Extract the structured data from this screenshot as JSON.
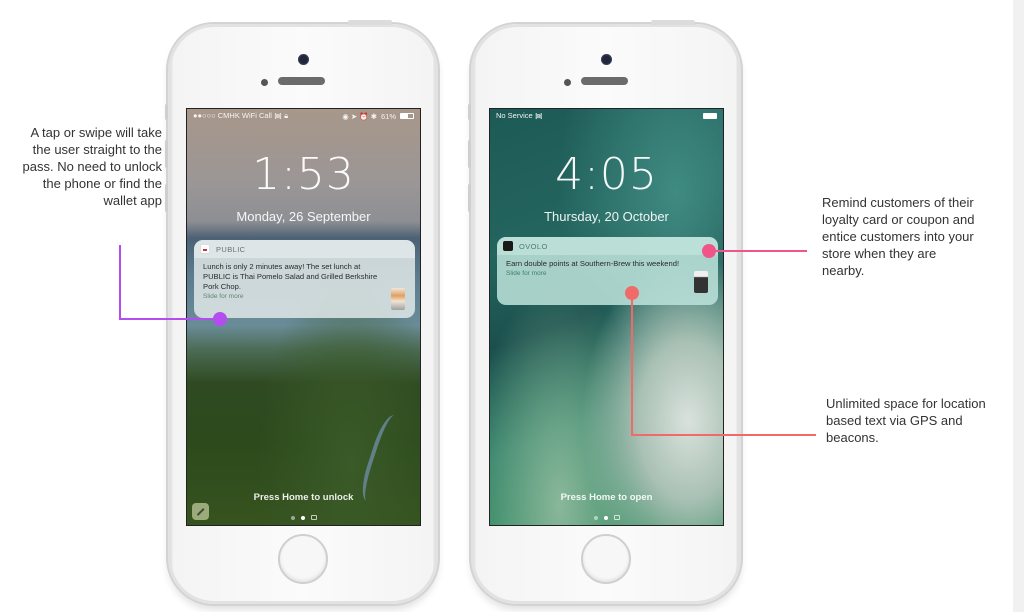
{
  "callouts": {
    "left": "A tap or swipe will take the user straight to the pass. No need to unlock the phone or find the wallet app",
    "right_top": "Remind customers of their loyalty card or coupon and entice customers into your store when they are nearby.",
    "right_bottom": "Unlimited space for location based text via GPS and beacons."
  },
  "colors": {
    "purple_marker": "#b44df0",
    "pink_marker": "#f0558a",
    "coral_marker": "#f06a6a"
  },
  "phones": [
    {
      "status": {
        "carrier": "●●○○○ CMHK WiFi Call",
        "wifi_icon": "wifi-icon",
        "lock_icon": "lock-icon",
        "right_icons": "◉ ➤ ⏰ ✱",
        "battery_text": "61%",
        "battery_level": 0.61
      },
      "time": "1:53",
      "date": "Monday, 26 September",
      "notification": {
        "app": "PUBLIC",
        "body": "Lunch is only 2 minutes away! The set lunch at PUBLIC is Thai Pomelo Salad and Grilled Berkshire Pork Chop.",
        "more": "Slide for more"
      },
      "bottom_text": "Press Home to unlock"
    },
    {
      "status": {
        "carrier": "No Service",
        "wifi_icon": "wifi-icon",
        "battery_level": 1.0
      },
      "time": "4:05",
      "date": "Thursday, 20 October",
      "notification": {
        "app": "OVOLO",
        "body": "Earn double points at Southern-Brew this weekend!",
        "more": "Slide for more"
      },
      "bottom_text": "Press Home to open"
    }
  ]
}
